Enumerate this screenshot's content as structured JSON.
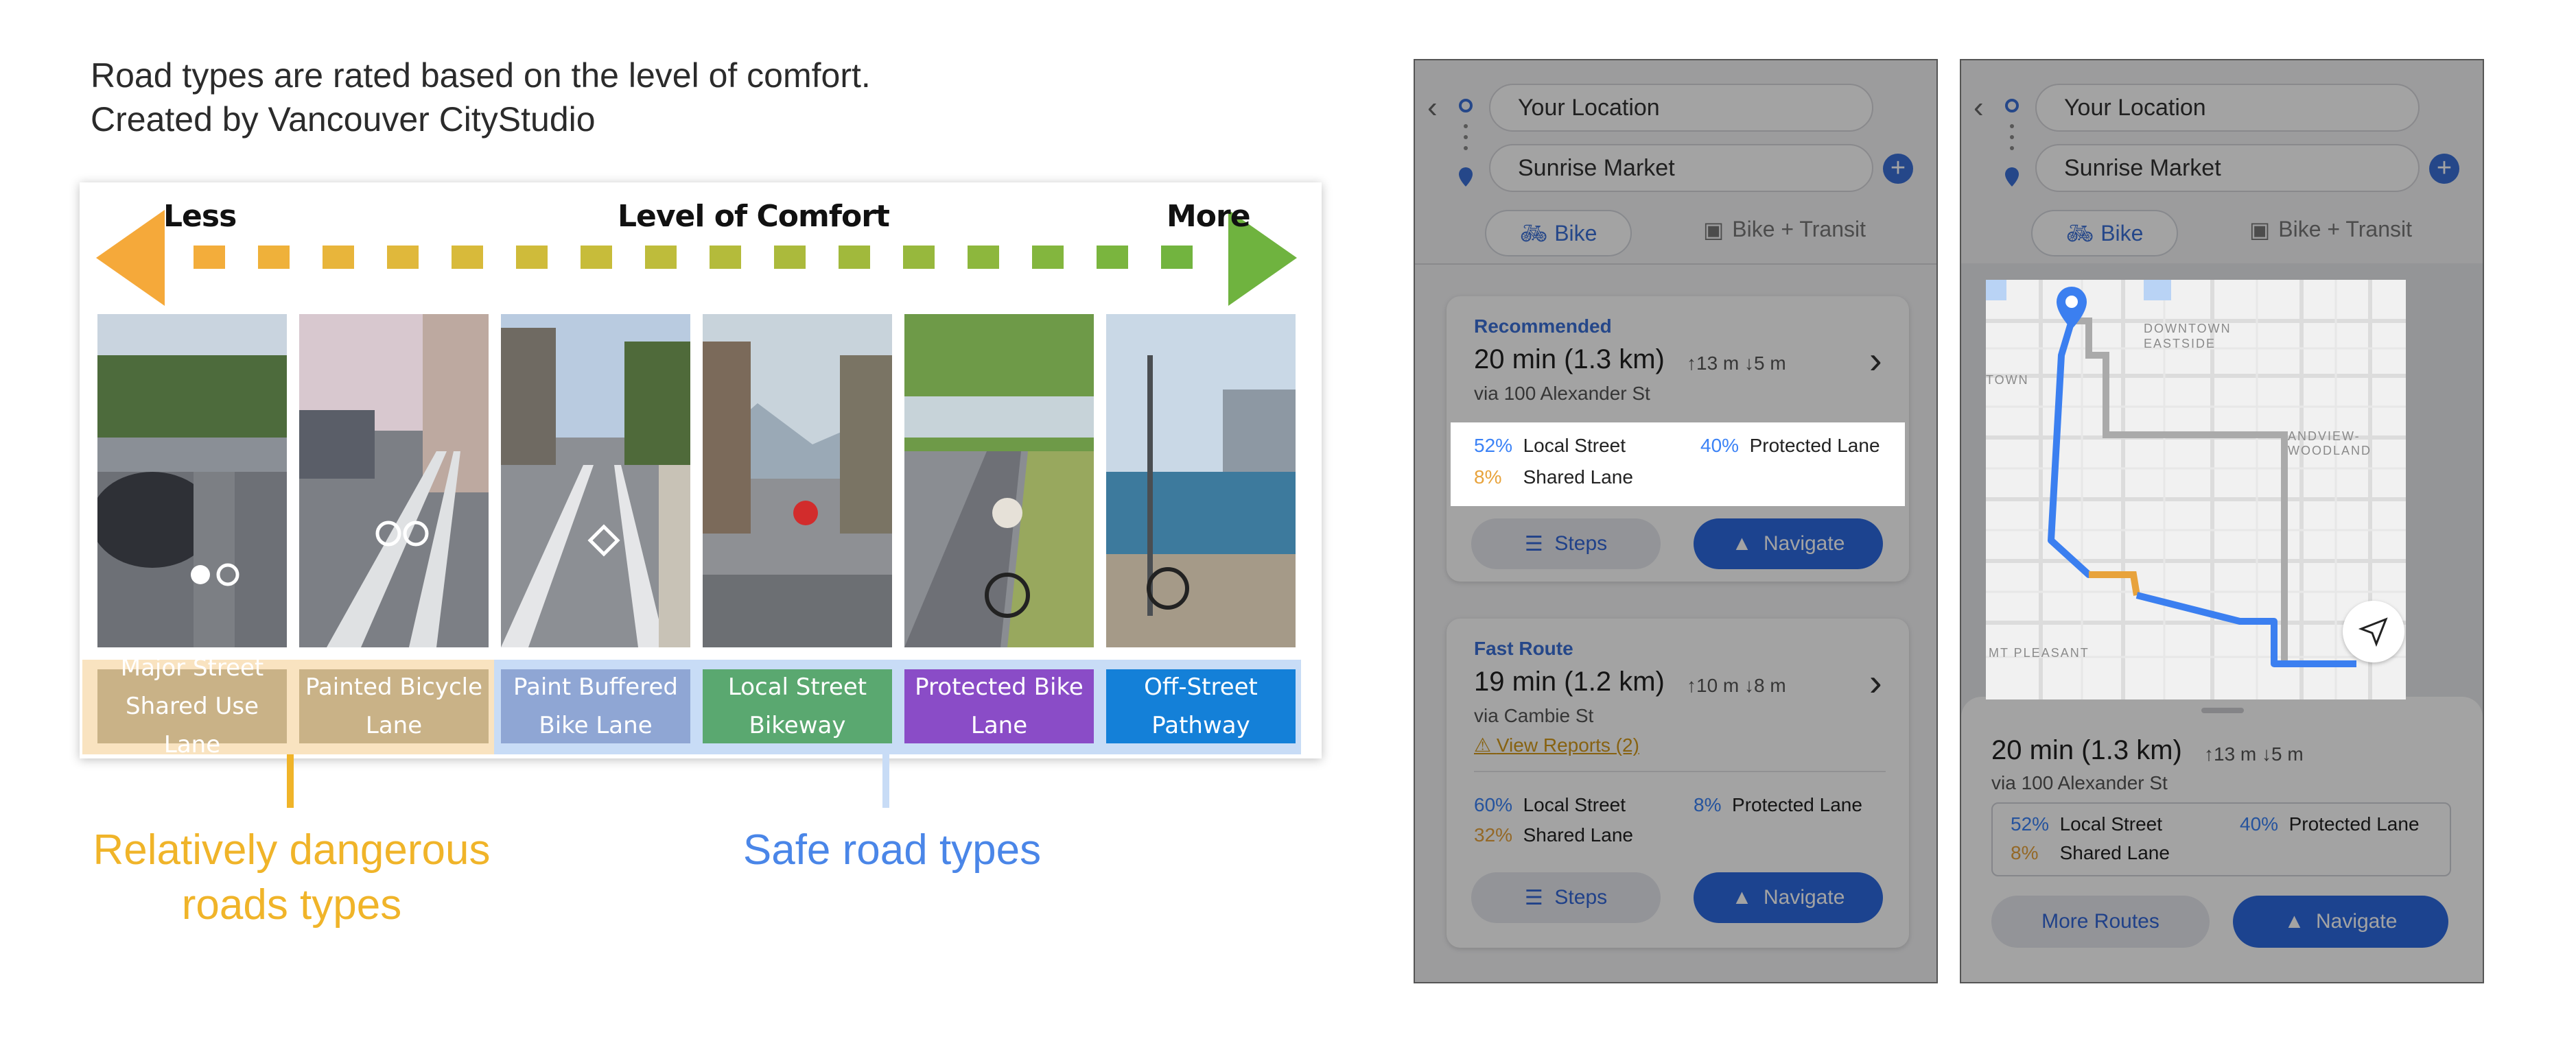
{
  "description": {
    "line1": "Road types are rated based on the level of comfort.",
    "line2": "Created by Vancouver CityStudio"
  },
  "comfort_scale": {
    "less_label": "Less",
    "title": "Level of Comfort",
    "more_label": "More",
    "categories": [
      {
        "line1": "Major Street",
        "line2": "Shared Use Lane",
        "color": "#c9b287"
      },
      {
        "line1": "Painted Bicycle",
        "line2": "Lane",
        "color": "#c9b287"
      },
      {
        "line1": "Paint Buffered",
        "line2": "Bike Lane",
        "color": "#8fa6d4"
      },
      {
        "line1": "Local Street",
        "line2": "Bikeway",
        "color": "#5aa870"
      },
      {
        "line1": "Protected Bike",
        "line2": "Lane",
        "color": "#8a4cc7"
      },
      {
        "line1": "Off-Street",
        "line2": "Pathway",
        "color": "#1480d8"
      }
    ],
    "arrow_colors": {
      "less": "#f5a93a",
      "more": "#6fb33f"
    }
  },
  "groups": {
    "dangerous_label_line1": "Relatively dangerous",
    "dangerous_label_line2": "roads types",
    "dangerous_color": "#f0b429",
    "safe_label": "Safe road types",
    "safe_color": "#4a86e8"
  },
  "phone1": {
    "origin": "Your Location",
    "destination": "Sunrise Market",
    "mode_bike": "Bike",
    "mode_transit": "Bike + Transit",
    "routes": [
      {
        "tag": "Recommended",
        "time": "20 min (1.3 km)",
        "elev_up": "↑13 m",
        "elev_down": "↓5 m",
        "via": "via 100 Alexander St",
        "stat1_pct": "52%",
        "stat1_label": "Local Street",
        "stat2_pct": "40%",
        "stat2_label": "Protected Lane",
        "stat3_pct": "8%",
        "stat3_label": "Shared Lane",
        "steps": "Steps",
        "navigate": "Navigate"
      },
      {
        "tag": "Fast Route",
        "time": "19 min (1.2 km)",
        "elev_up": "↑10 m",
        "elev_down": "↓8 m",
        "via": "via Cambie St",
        "reports": "View Reports (2)",
        "stat1_pct": "60%",
        "stat1_label": "Local Street",
        "stat2_pct": "8%",
        "stat2_label": "Protected Lane",
        "stat3_pct": "32%",
        "stat3_label": "Shared Lane",
        "steps": "Steps",
        "navigate": "Navigate"
      }
    ]
  },
  "phone2": {
    "origin": "Your Location",
    "destination": "Sunrise Market",
    "mode_bike": "Bike",
    "mode_transit": "Bike + Transit",
    "map_labels": {
      "downtown": "DOWNTOWN",
      "eastside": "EASTSIDE",
      "grandview": "ANDVIEW-WOODLAND",
      "town": "TOWN",
      "pleasant": "MT PLEASANT"
    },
    "summary": {
      "time": "20 min (1.3 km)",
      "elev_up": "↑13 m",
      "elev_down": "↓5 m",
      "via": "via 100 Alexander St",
      "stat1_pct": "52%",
      "stat1_label": "Local Street",
      "stat2_pct": "40%",
      "stat2_label": "Protected Lane",
      "stat3_pct": "8%",
      "stat3_label": "Shared Lane"
    },
    "more_routes": "More Routes",
    "navigate": "Navigate"
  }
}
